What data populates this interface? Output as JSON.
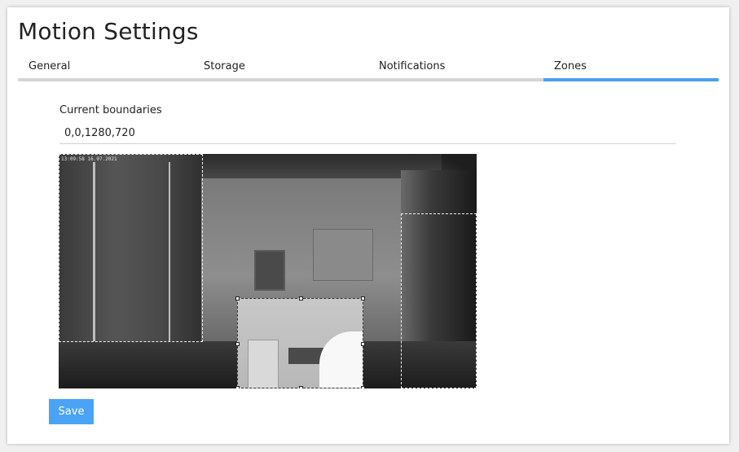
{
  "page": {
    "title": "Motion Settings"
  },
  "tabs": [
    {
      "label": "General",
      "active": false
    },
    {
      "label": "Storage",
      "active": false
    },
    {
      "label": "Notifications",
      "active": false
    },
    {
      "label": "Zones",
      "active": true
    }
  ],
  "boundaries": {
    "label": "Current boundaries",
    "value": "0,0,1280,720"
  },
  "camera": {
    "timestamp": "13:09:58 16.07.2021"
  },
  "actions": {
    "save_label": "Save"
  },
  "colors": {
    "accent": "#4a9ff0",
    "button": "#4aa3f5",
    "tab_inactive": "#d5d5d5"
  }
}
